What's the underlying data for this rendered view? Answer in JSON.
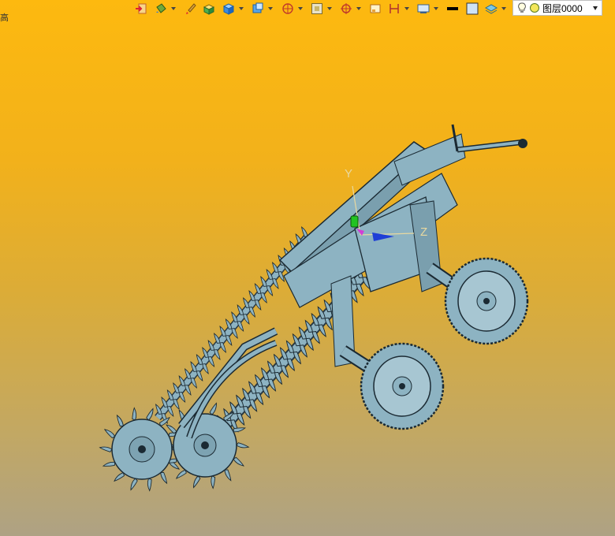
{
  "toolbar": {
    "left_glyph": "高",
    "icons": [
      "import-icon",
      "paint-bucket-icon",
      "brush-icon",
      "box-solid-icon",
      "cube-icon",
      "view-cube-icon",
      "sphere-wire-icon",
      "frame-icon",
      "move-target-icon",
      "rect-select-icon",
      "dimension-icon",
      "display-mode-icon",
      "color-black-icon",
      "color-light-icon",
      "layer-stack-icon"
    ]
  },
  "layer": {
    "name": "图层0000",
    "bulb_icon": "lightbulb-icon",
    "status_icon": "yellow-circle-icon"
  },
  "viewport": {
    "axis_y": "Y",
    "axis_z": "Z",
    "model_color": "#8db3c2",
    "background_top": "#fdb90f",
    "background_bottom": "#aea284"
  }
}
